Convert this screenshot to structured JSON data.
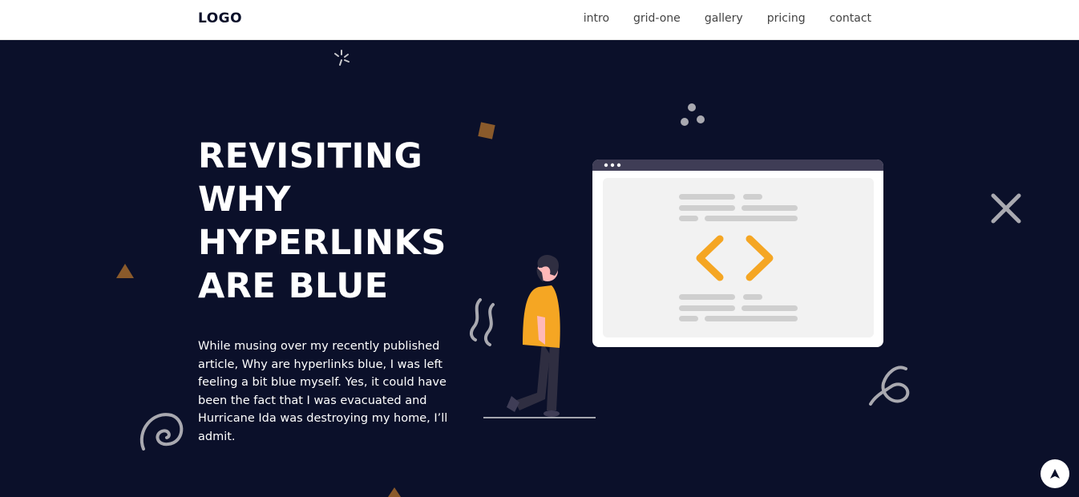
{
  "nav": {
    "logo": "LOGO",
    "links": [
      "intro",
      "grid-one",
      "gallery",
      "pricing",
      "contact"
    ]
  },
  "hero": {
    "title_lines": [
      "REVISITING",
      "WHY",
      "HYPERLINKS",
      "ARE BLUE"
    ],
    "paragraph": "While musing over my recently published article, Why are hyperlinks blue, I was left feeling a bit blue myself. Yes, it could have been the fact that I was evacuated and Hurricane Ida was destroying my home, I’ll admit."
  },
  "colors": {
    "background": "#0b102a",
    "accent_orange": "#f5a623",
    "deco_brown": "#8a5a2b",
    "deco_gray": "#a9a9b0"
  },
  "icons": {
    "scroll_top": "arrow-up-icon",
    "code": "code-brackets-icon"
  }
}
